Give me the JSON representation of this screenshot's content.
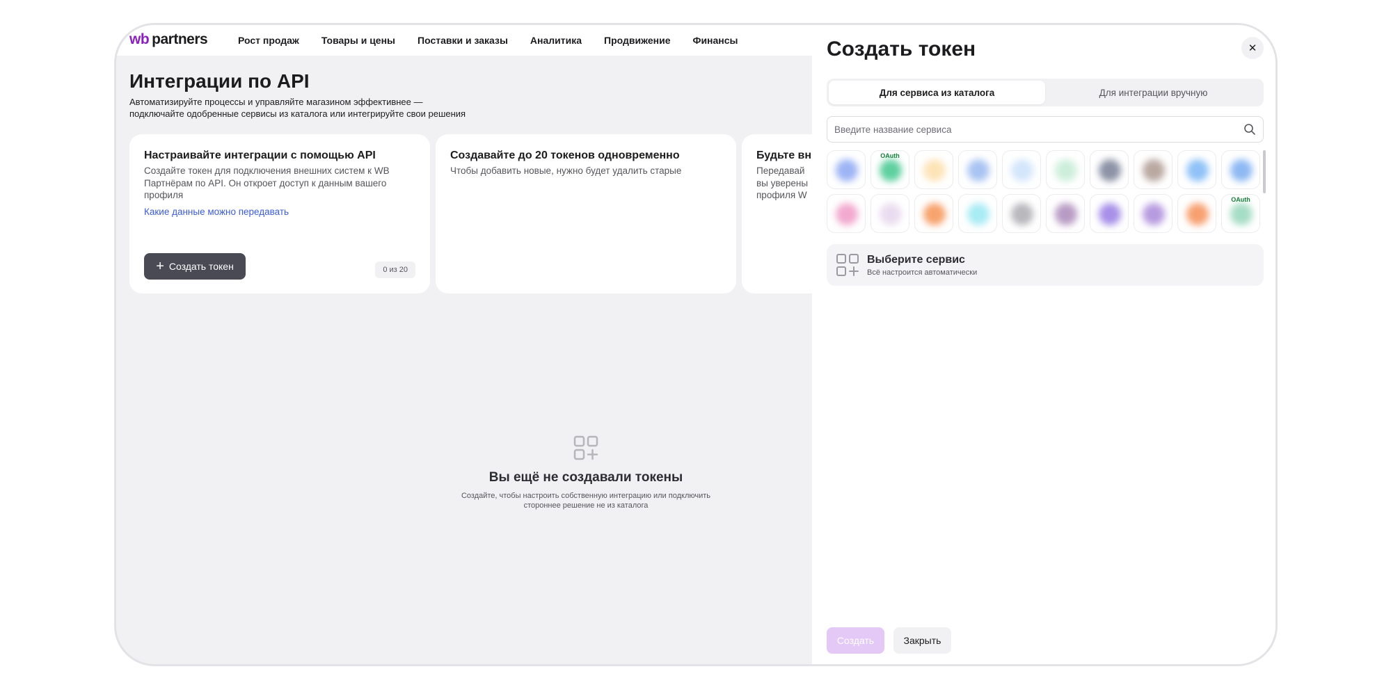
{
  "header": {
    "logo_wb": "wb",
    "logo_partners": "partners",
    "nav": [
      "Рост продаж",
      "Товары и цены",
      "Поставки и заказы",
      "Аналитика",
      "Продвижение",
      "Финансы"
    ]
  },
  "page": {
    "title": "Интеграции по API",
    "subtitle_line1": "Автоматизируйте процессы и управляйте магазином эффективнее —",
    "subtitle_line2": "подключайте одобренные сервисы из каталога или интегрируйте свои решения"
  },
  "cards": [
    {
      "title": "Настраивайте интеграции с помощью API",
      "text": "Создайте токен для подключения внешних систем к WB Партнёрам по API. Он откроет доступ к данным вашего профиля",
      "link": "Какие данные можно передавать",
      "button": "Создать токен",
      "counter": "0 из 20"
    },
    {
      "title": "Создавайте до 20 токенов одновременно",
      "text": "Чтобы добавить новые, нужно будет удалить старые"
    },
    {
      "title": "Будьте вни",
      "text_line1": "Передавай",
      "text_line2": "вы уверены",
      "text_line3": "профиля W"
    }
  ],
  "empty_state": {
    "title": "Вы ещё не создавали токены",
    "text_line1": "Создайте, чтобы настроить собственную интеграцию или подключить",
    "text_line2": "стороннее решение не из каталога"
  },
  "panel": {
    "title": "Создать токен",
    "tabs": [
      "Для сервиса из каталога",
      "Для интеграции вручную"
    ],
    "active_tab": 0,
    "search_placeholder": "Введите название сервиса",
    "tiles": [
      {
        "color": "#9db4f5",
        "badge": ""
      },
      {
        "color": "#5fd0a0",
        "badge": "OAuth"
      },
      {
        "color": "#fde4b8",
        "badge": ""
      },
      {
        "color": "#a9c4f2",
        "badge": ""
      },
      {
        "color": "#d3e6fb",
        "badge": ""
      },
      {
        "color": "#cdeedb",
        "badge": ""
      },
      {
        "color": "#8c93a6",
        "badge": ""
      },
      {
        "color": "#b9a8a0",
        "badge": ""
      },
      {
        "color": "#8fc2f7",
        "badge": ""
      },
      {
        "color": "#8eb9f3",
        "badge": ""
      },
      {
        "color": "#f2a9cf",
        "badge": ""
      },
      {
        "color": "#eadcf0",
        "badge": ""
      },
      {
        "color": "#f7a36d",
        "badge": ""
      },
      {
        "color": "#a8ecf4",
        "badge": ""
      },
      {
        "color": "#b8b8bd",
        "badge": ""
      },
      {
        "color": "#b89bc4",
        "badge": ""
      },
      {
        "color": "#a890e8",
        "badge": ""
      },
      {
        "color": "#b79be0",
        "badge": ""
      },
      {
        "color": "#f7a070",
        "badge": ""
      },
      {
        "color": "#a6ddc6",
        "badge": "OAuth"
      }
    ],
    "choose_title": "Выберите сервис",
    "choose_sub": "Всё настроится автоматически",
    "submit": "Создать",
    "close": "Закрыть"
  }
}
